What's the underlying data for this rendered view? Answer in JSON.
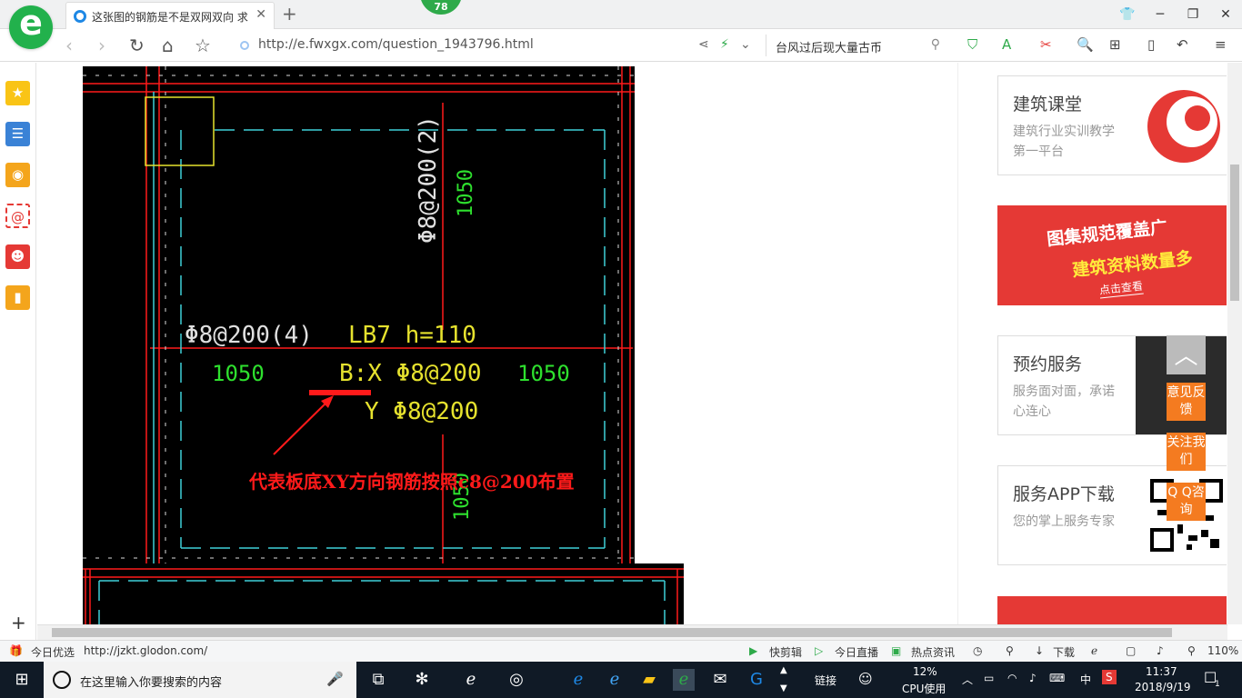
{
  "browser": {
    "tab_title": "这张图的钢筋是不是双网双向 求",
    "badge": "78",
    "url": "http://e.fwxgx.com/question_1943796.html",
    "search_text": "台风过后现大量古币"
  },
  "cad": {
    "top_bar_label": "Φ8@200(2)",
    "top_length": "1050",
    "left_bar_label": "Φ8@200(4)",
    "left_length": "1050",
    "right_length": "1050",
    "slab_id": "LB7 h=110",
    "bottom_x": "B:X Φ8@200",
    "bottom_y": "Y Φ8@200",
    "bottom_length": "1050",
    "annotation": "代表板底XY方向钢筋按照c8@200布置"
  },
  "right_panel": {
    "card1": {
      "title": "建筑课堂",
      "text": "建筑行业实训教学第一平台"
    },
    "promo": {
      "line1": "图集规范覆盖广",
      "line2": "建筑资料数量多",
      "button": "点击查看"
    },
    "card2": {
      "title": "预约服务",
      "text": "服务面对面，承诺心连心"
    },
    "card3": {
      "title": "服务APP下载",
      "text": "您的掌上服务专家"
    }
  },
  "float_buttons": {
    "feedback": "意见反馈",
    "follow": "关注我们",
    "qq": "Q Q咨询"
  },
  "status_bar": {
    "today": "今日优选",
    "url": "http://jzkt.glodon.com/",
    "quick_clip": "快剪辑",
    "live": "今日直播",
    "news": "热点资讯",
    "download": "下载",
    "zoom": "110%"
  },
  "taskbar": {
    "search_placeholder": "在这里输入你要搜索的内容",
    "links": "链接",
    "cpu_percent": "12%",
    "cpu_label": "CPU使用",
    "ime": "中",
    "time": "11:37",
    "date": "2018/9/19",
    "notifications": "1"
  },
  "colors": {
    "cad_bg": "#000000",
    "cad_red": "#ff1a1a",
    "cad_cyan": "#3fd0d8",
    "cad_green": "#2ee02e",
    "cad_yellow": "#e6e22e",
    "accent_orange": "#f47b20"
  }
}
